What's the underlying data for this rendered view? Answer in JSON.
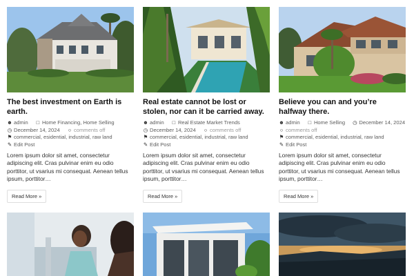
{
  "posts": [
    {
      "title": "The best investment on Earth is earth.",
      "author": "admin",
      "categories": "Home Financing, Home Selling",
      "date": "December 14, 2024",
      "comments": "comments off",
      "tags": "commercial, esidential, industrial, raw land",
      "edit": "Edit Post",
      "excerpt": "Lorem ipsum dolor sit amet, consectetur adipiscing elit. Cras pulvinar enim eu odio porttitor, ut vsarius mi consequat. Aenean tellus ipsum, porttitor…",
      "read_more": "Read More »"
    },
    {
      "title": "Real estate cannot be lost or stolen, nor can it be carried away.",
      "author": "admin",
      "categories": "Real Estate Market Trends",
      "date": "December 14, 2024",
      "comments": "comments off",
      "tags": "commercial, esidential, industrial, raw land",
      "edit": "Edit Post",
      "excerpt": "Lorem ipsum dolor sit amet, consectetur adipiscing elit. Cras pulvinar enim eu odio porttitor, ut vsarius mi consequat. Aenean tellus ipsum, porttitor…",
      "read_more": "Read More »"
    },
    {
      "title": "Believe you can and you’re halfway there.",
      "author": "admin",
      "categories": "Home Selling",
      "date": "December 14, 2024",
      "comments": "comments off",
      "tags": "commercial, esidential, industrial, raw land",
      "edit": "Edit Post",
      "excerpt": "Lorem ipsum dolor sit amet, consectetur adipiscing elit. Cras pulvinar enim eu odio porttitor, ut vsarius mi consequat. Aenean tellus ipsum, porttitor…",
      "read_more": "Read More »"
    }
  ],
  "icons": {
    "author": "user-icon",
    "category": "folder-icon",
    "date": "clock-icon",
    "comments": "comment-icon",
    "tags": "tag-icon",
    "edit": "edit-icon"
  },
  "colors": {
    "text": "#1f1f1f",
    "meta": "#5c5c5c",
    "muted": "#9a9a9a",
    "border": "#dedede"
  }
}
